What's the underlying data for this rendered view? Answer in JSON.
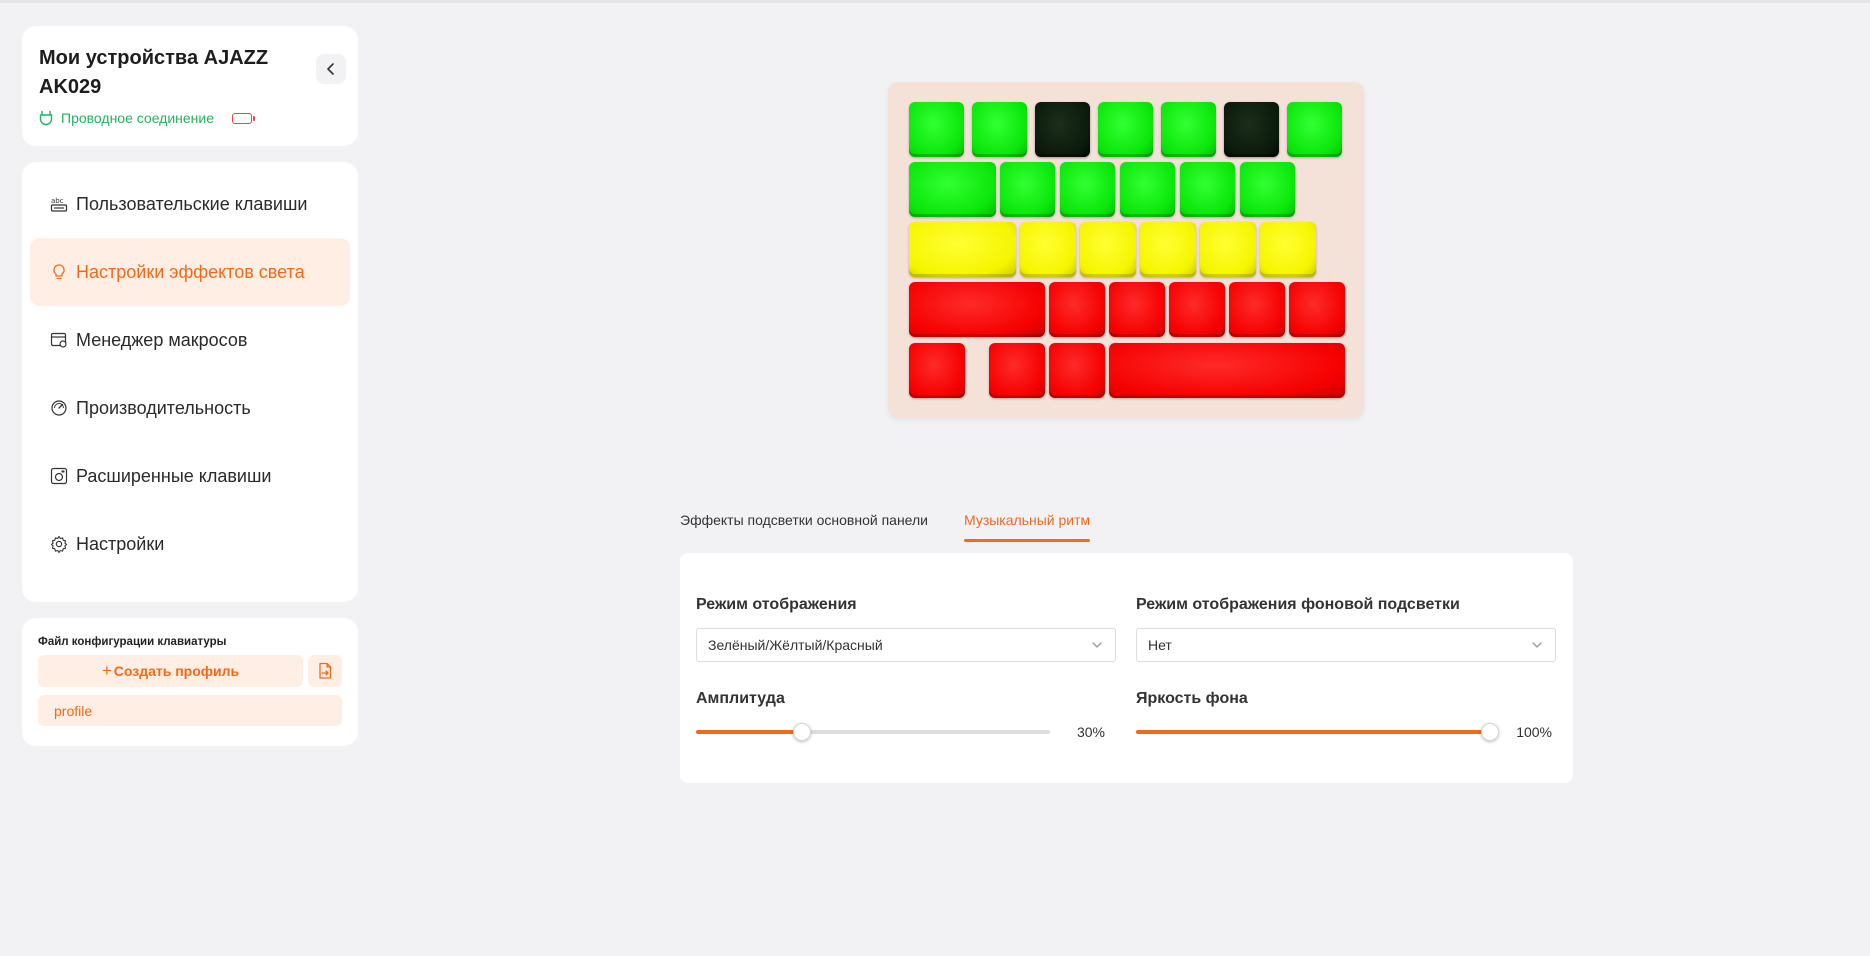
{
  "device": {
    "title": "Мои устройства AJAZZ AK029",
    "connection": "Проводное соединение"
  },
  "menu": {
    "items": [
      {
        "label": "Пользовательские клавиши",
        "icon": "abc-keys-icon"
      },
      {
        "label": "Настройки эффектов света",
        "icon": "lightbulb-icon"
      },
      {
        "label": "Менеджер макросов",
        "icon": "macro-window-icon"
      },
      {
        "label": "Производительность",
        "icon": "gauge-icon"
      },
      {
        "label": "Расширенные клавиши",
        "icon": "advanced-key-icon"
      },
      {
        "label": "Настройки",
        "icon": "gear-icon"
      }
    ],
    "active_index": 1
  },
  "config": {
    "title": "Файл конфигурации клавиатуры",
    "create_label": "Создать профиль",
    "profiles": [
      "profile"
    ]
  },
  "keyboard": {
    "key_colors": {
      "green": "#0ae60a",
      "dark": "#0b1a0b",
      "yellow": "#f5f500",
      "red": "#f50000"
    }
  },
  "tabs": [
    {
      "label": "Эффекты подсветки основной панели",
      "active": false
    },
    {
      "label": "Музыкальный ритм",
      "active": true
    }
  ],
  "settings": {
    "display_mode": {
      "label": "Режим отображения",
      "value": "Зелёный/Жёлтый/Красный"
    },
    "background_mode": {
      "label": "Режим отображения фоновой подсветки",
      "value": "Нет"
    },
    "amplitude": {
      "label": "Амплитуда",
      "value": 30,
      "value_text": "30%"
    },
    "background_brightness": {
      "label": "Яркость фона",
      "value": 100,
      "value_text": "100%"
    }
  },
  "colors": {
    "accent": "#f16a1c",
    "accent_bg": "#ffeee3",
    "connected": "#20b560"
  }
}
